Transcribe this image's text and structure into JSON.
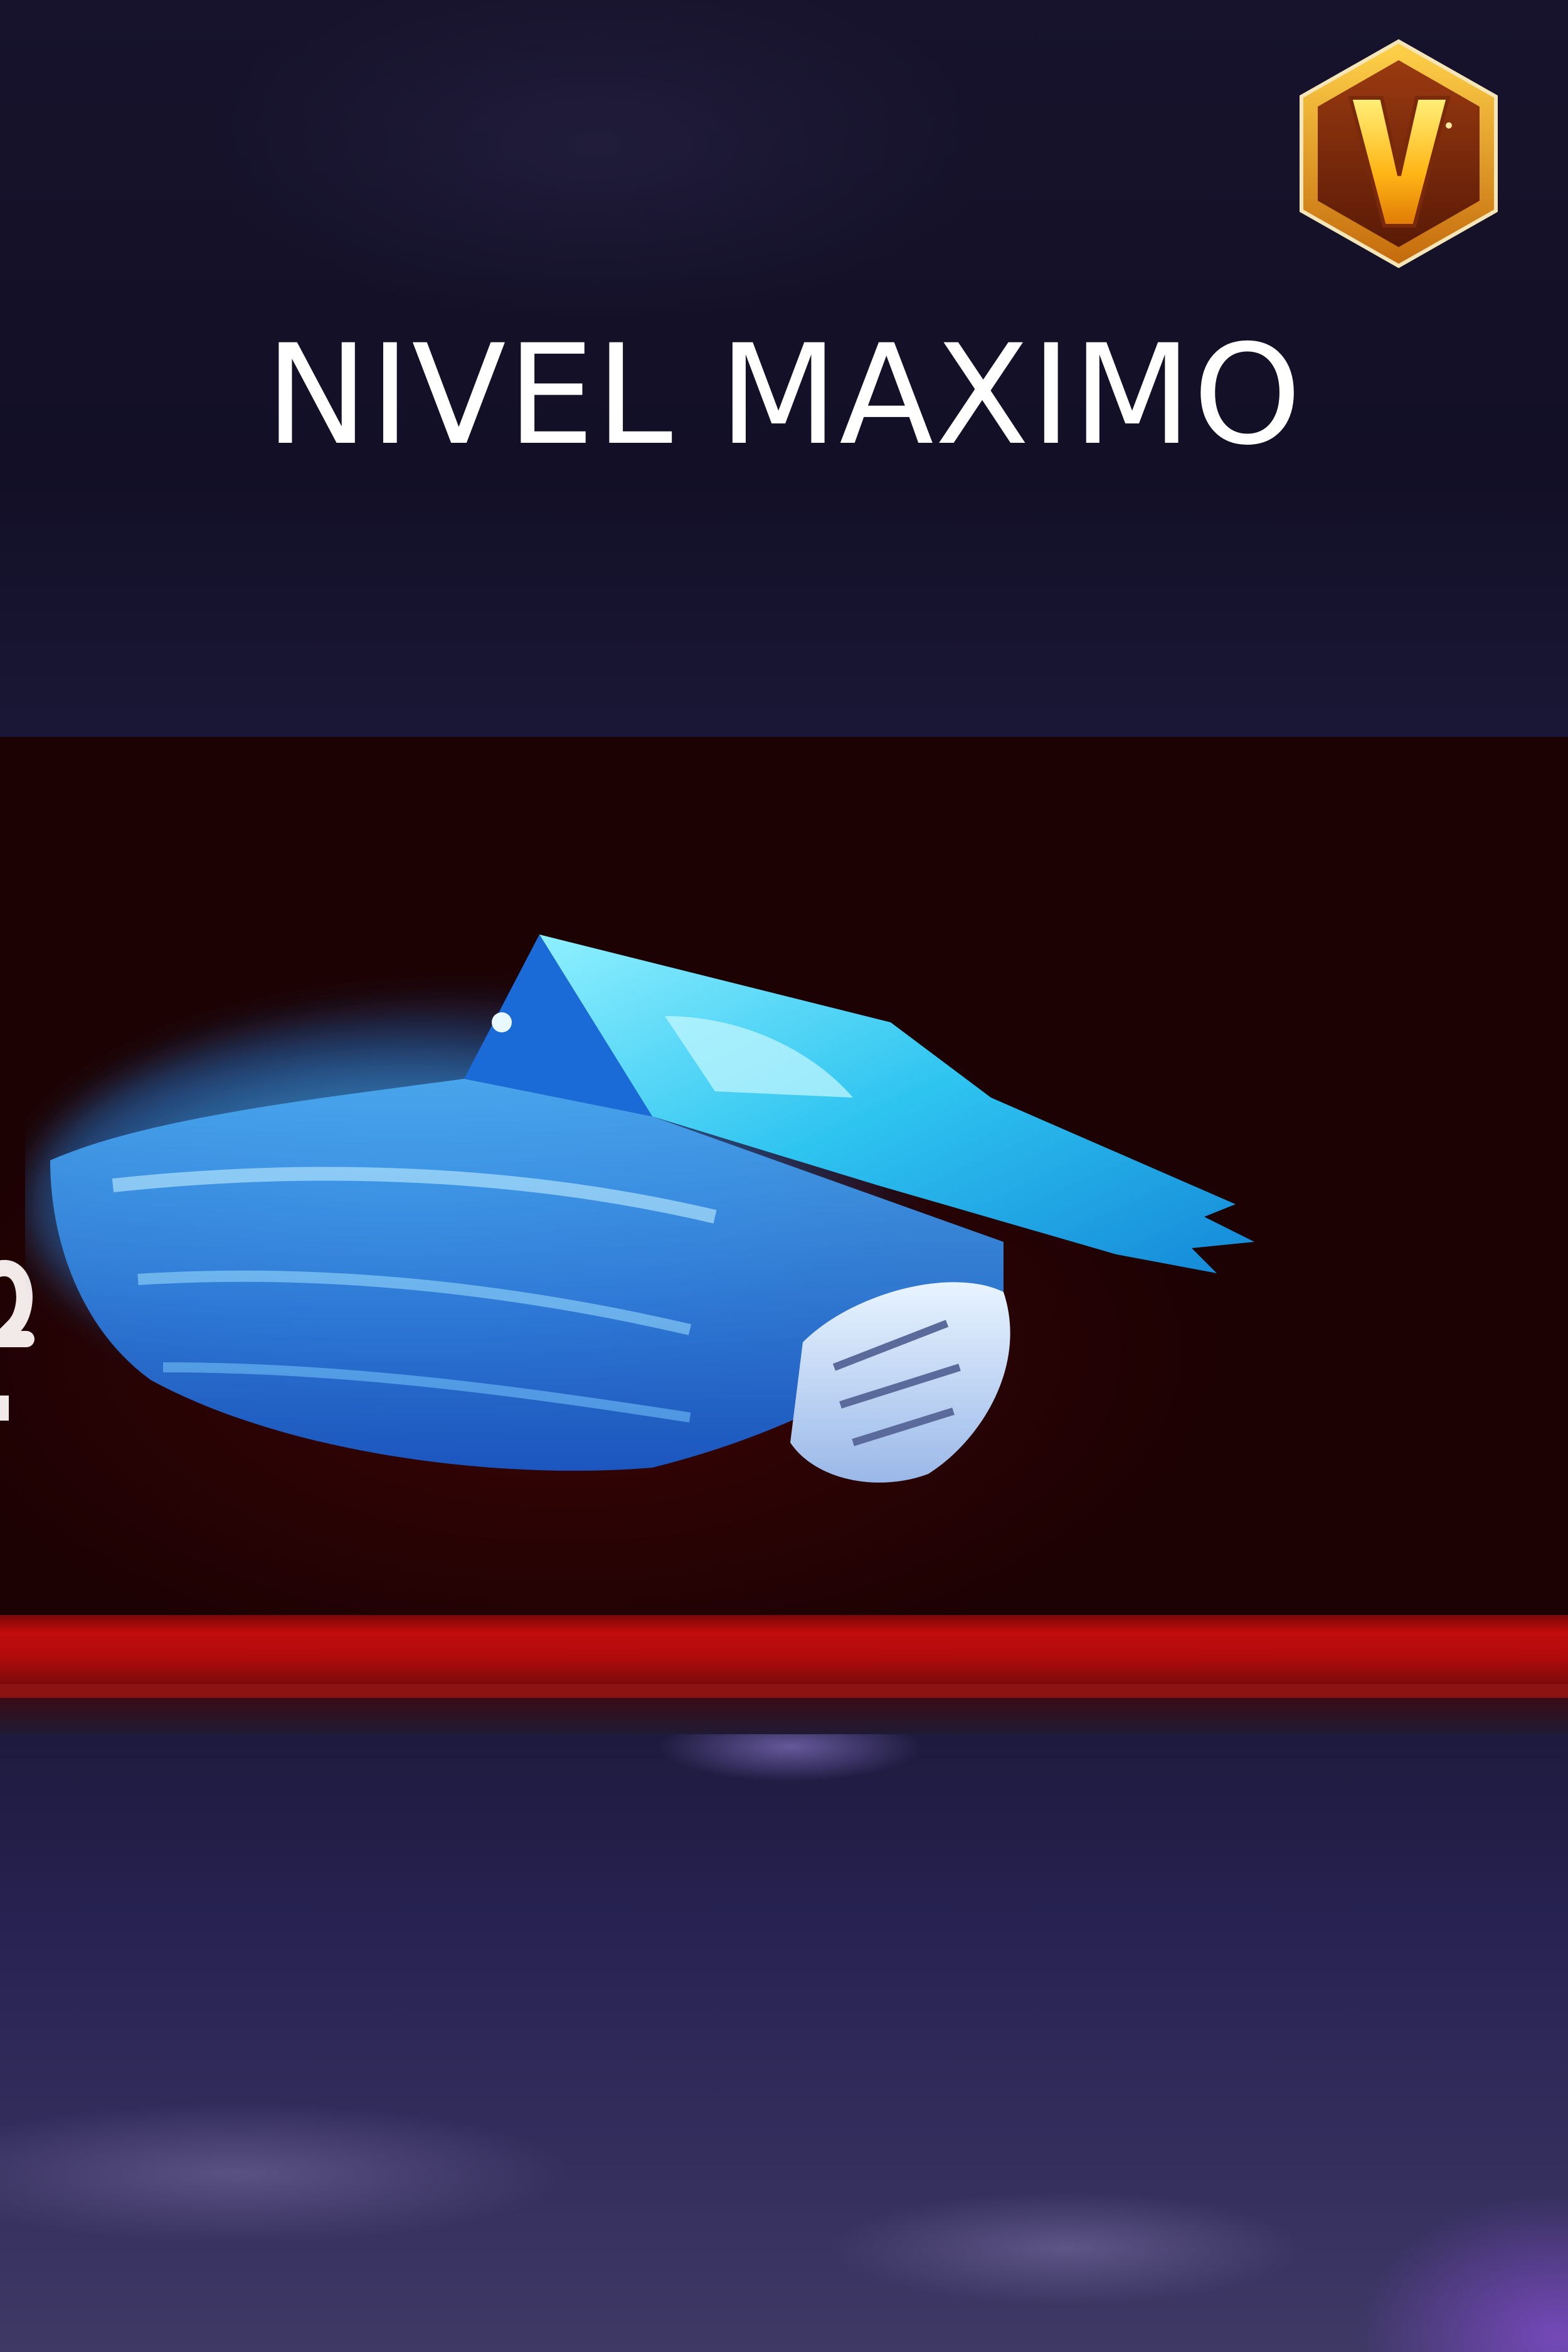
{
  "screen": {
    "title": "NIVEL MAXIMO"
  },
  "rank_badge": {
    "icon": "v-badge-icon",
    "letter": "V",
    "colors": {
      "border": "#e8a21a",
      "inner": "#7a2a0a",
      "letter": "#ffc21a"
    }
  },
  "featured_item": {
    "icon": "blue-flame-gloves-icon",
    "colors": {
      "primary": "#38c8f0",
      "secondary": "#1a6ad8",
      "banner": "#2a0304",
      "stripe": "#c10c0d"
    }
  }
}
